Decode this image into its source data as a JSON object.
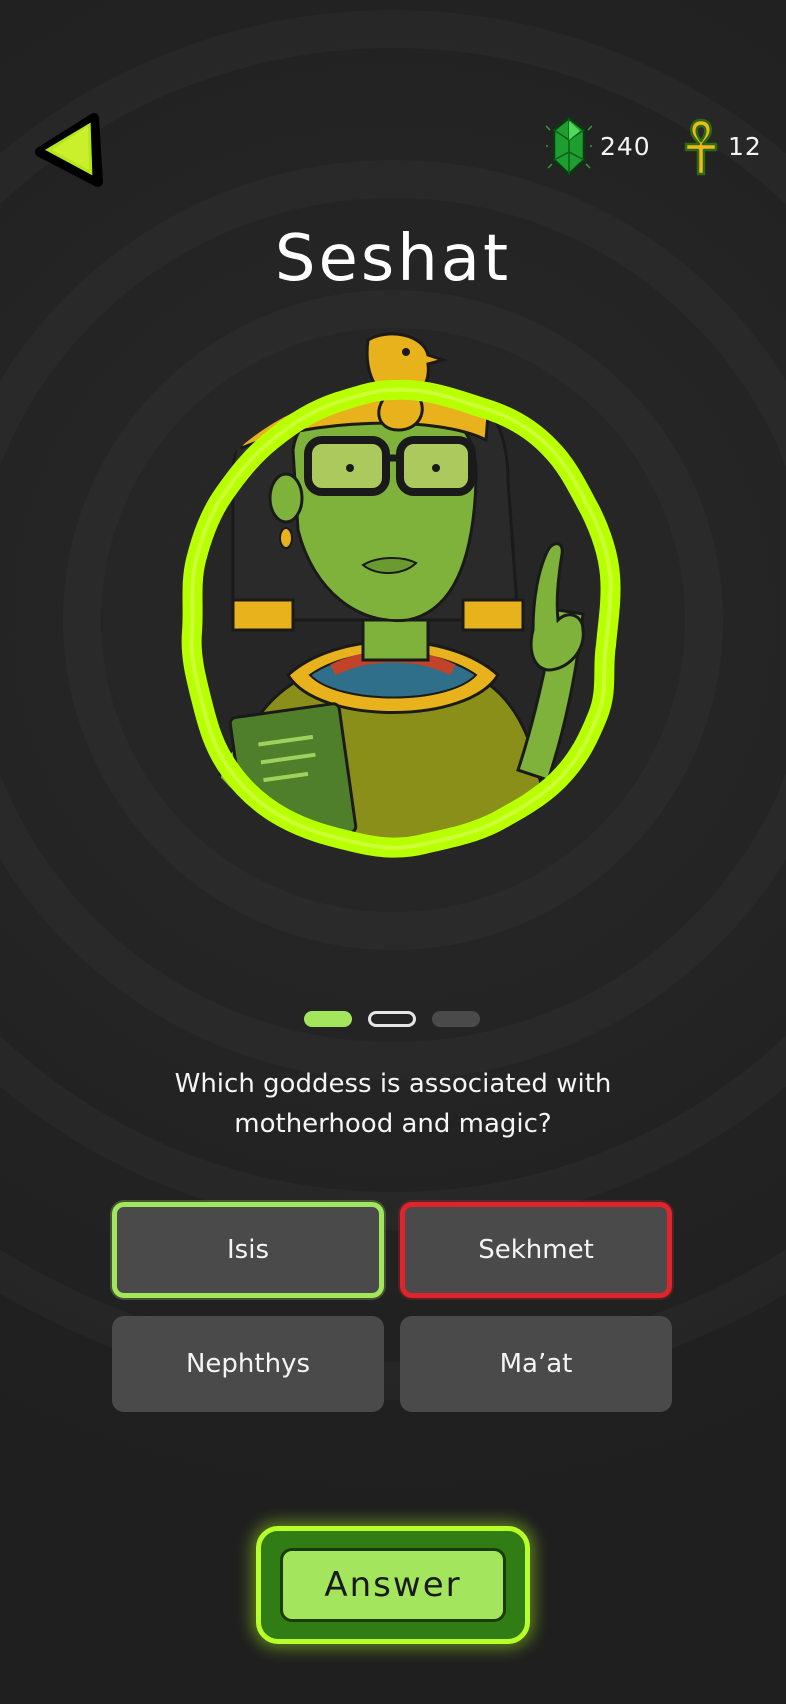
{
  "header": {
    "back_icon": "back-arrow-icon",
    "gems": {
      "icon": "green-gem-icon",
      "count": "240"
    },
    "ankhs": {
      "icon": "ankh-icon",
      "count": "12"
    }
  },
  "character": {
    "name": "Seshat",
    "portrait": "seshat-portrait"
  },
  "progress": {
    "total_steps": 3,
    "current_step": 1
  },
  "quiz": {
    "question": "Which goddess is associated with motherhood and magic?",
    "options": [
      {
        "label": "Isis",
        "state": "correct"
      },
      {
        "label": "Sekhmet",
        "state": "wrong"
      },
      {
        "label": "Nephthys",
        "state": "none"
      },
      {
        "label": "Ma’at",
        "state": "none"
      }
    ],
    "answer_label": "Answer"
  },
  "colors": {
    "accent_green": "#a3e65e",
    "glow_green": "#b8ff2a",
    "wrong_red": "#e0242b",
    "option_bg": "#4a4a4a",
    "background": "#222222"
  }
}
